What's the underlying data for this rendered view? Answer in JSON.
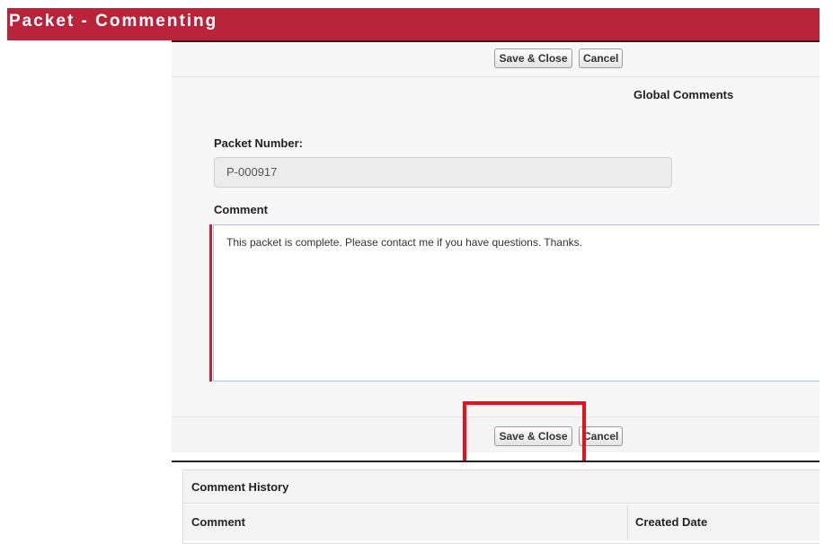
{
  "window": {
    "title": "Packet - Commenting"
  },
  "toolbar_top": {
    "save_label": "Save & Close",
    "cancel_label": "Cancel"
  },
  "form": {
    "section_title": "Global Comments",
    "packet_number_label": "Packet Number:",
    "packet_number_value": "P-000917",
    "comment_label": "Comment",
    "comment_value": "This packet is complete. Please contact me if you have questions. Thanks."
  },
  "toolbar_bottom": {
    "save_label": "Save & Close",
    "cancel_label": "Cancel"
  },
  "history": {
    "title": "Comment History",
    "columns": [
      "Comment",
      "Created Date"
    ]
  },
  "colors": {
    "title_bar": "#b8243a",
    "highlight": "#e8101a",
    "required_indicator": "#c0272d"
  }
}
